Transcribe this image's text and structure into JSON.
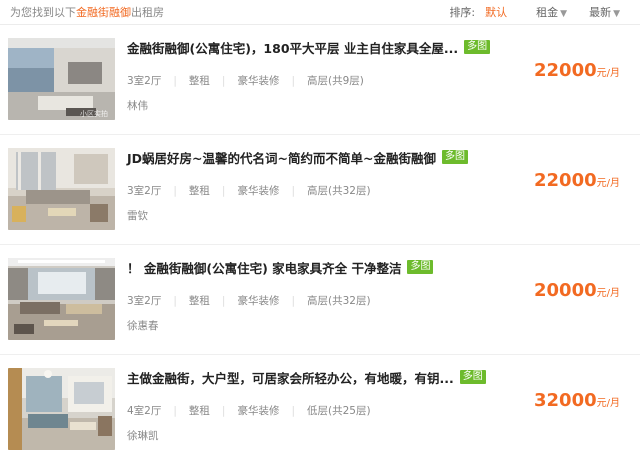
{
  "header": {
    "result_prefix": "为您找到以下",
    "community": "金融街融御",
    "result_suffix": "出租房",
    "sort_label": "排序:",
    "sort_default": "默认",
    "sort_rent": "租金",
    "sort_latest": "最新",
    "sort_arrow_icon": "arrow-down-icon"
  },
  "listings": [
    {
      "title": "金融街融御(公寓住宅)，180平大平层 业主自住家具全屋...",
      "badge": "多图",
      "layout": "3室2厅",
      "rent_type": "整租",
      "decoration": "豪华装修",
      "floor": "高层(共9层)",
      "agent": "林伟",
      "price": "22000",
      "unit": "元/月",
      "photo_watermark": "小区实拍"
    },
    {
      "title": "JD蜗居好房~温馨的代名词~简约而不简单~金融街融御",
      "badge": "多图",
      "layout": "3室2厅",
      "rent_type": "整租",
      "decoration": "豪华装修",
      "floor": "高层(共32层)",
      "agent": "雷钦",
      "price": "22000",
      "unit": "元/月"
    },
    {
      "title": "！ 金融街融御(公寓住宅) 家电家具齐全 干净整洁",
      "badge": "多图",
      "layout": "3室2厅",
      "rent_type": "整租",
      "decoration": "豪华装修",
      "floor": "高层(共32层)",
      "agent": "徐惠春",
      "price": "20000",
      "unit": "元/月"
    },
    {
      "title": "主做金融街，大户型，可居家会所轻办公，有地暖，有钥...",
      "badge": "多图",
      "layout": "4室2厅",
      "rent_type": "整租",
      "decoration": "豪华装修",
      "floor": "低层(共25层)",
      "agent": "徐琳凯",
      "price": "32000",
      "unit": "元/月"
    }
  ],
  "colors": {
    "accent": "#f26a22",
    "badge": "#6dbb2c"
  }
}
